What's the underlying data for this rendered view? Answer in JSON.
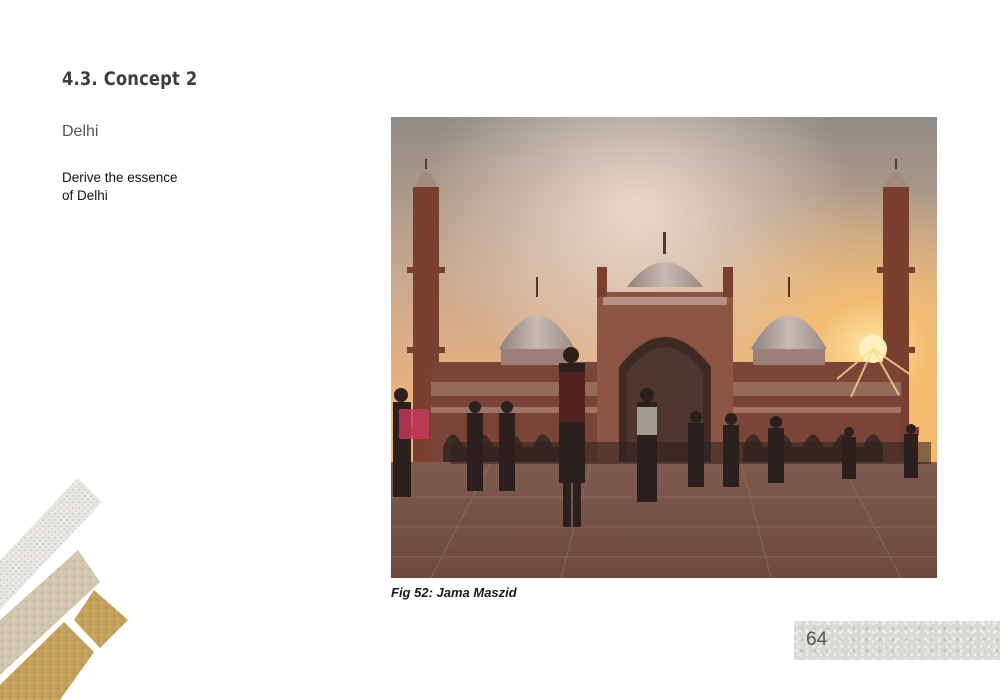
{
  "section": {
    "title": "4.3.  Concept 2"
  },
  "subtitle": "Delhi",
  "body_lines": [
    "Derive the essence",
    "of Delhi"
  ],
  "figure": {
    "caption": "Fig 52: Jama Maszid",
    "subject": "photo-jama-masjid"
  },
  "page": {
    "number": "64"
  },
  "colors": {
    "title": "#3d3d3d",
    "sky_top": "#9a948c",
    "sun": "#ffd27a",
    "sandstone": "#8a4b3a",
    "marble": "#b7a9a2",
    "gold_texture": "#c8a85a",
    "stone_texture": "#cfc6b8"
  }
}
